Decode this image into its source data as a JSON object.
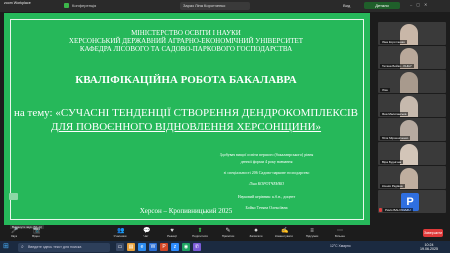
{
  "topbar": {
    "brand": "zoom Workplace",
    "conference": "Конференція",
    "speaker": "Зараз Ліна Коротченко",
    "view": "Вид",
    "pill": "Детали"
  },
  "slide": {
    "heading_1": "МІНІСТЕРСТВО ОСВІТИ І НАУКИ",
    "heading_2": "ХЕРСОНСЬКИЙ ДЕРЖАВНИЙ АГРАРНО-ЕКОНОМІЧНИЙ УНІВЕРСИТЕТ",
    "heading_3": "КАФЕДРА ЛІСОВОГО ТА САДОВО-ПАРКОВОГО ГОСПОДАРСТВА",
    "title": "КВАЛІФІКАЦІЙНА РОБОТА БАКАЛАВРА",
    "topic_line1": "на тему: «СУЧАСНІ ТЕНДЕНЦІЇ СТВОРЕННЯ ДЕНДРОКОМПЛЕКСІВ",
    "topic_line2": "ДЛЯ ПОВОЄННОГО ВІДНОВЛЕННЯ ХЕРСОНЩИНИ»",
    "info_1": "Здобувач вищої освіти першого (бакалаврського) рівня",
    "info_2": "денної форми 4 року навчання",
    "info_3": "зі спеціальності 206 Садово-паркове господарство",
    "info_4": "Ліна КОРОТЧЕНКО",
    "info_5": "Науковий керівник: к.б.н., доцент",
    "info_6": "Бойко Тетяна Олексіївна",
    "city_year": "Херсон – Кропивницький 2025"
  },
  "participants": [
    {
      "name": "Ліна Коротченко",
      "color": "#c9b7a8"
    },
    {
      "name": "Тетяна Бойко - KHGY",
      "color": "#b9a89a"
    },
    {
      "name": "Ліза",
      "color": "#a89a8d"
    },
    {
      "name": "Яна Малиганська",
      "color": "#c6b9ad"
    },
    {
      "name": "Юля Мірошніченко",
      "color": "#b7aaa0"
    },
    {
      "name": "Віра Буднічна",
      "color": "#d3c5b8"
    },
    {
      "name": "Ксенія Рядівна",
      "color": "#bfae9f"
    },
    {
      "name": "Pavlo BAH KDAZU",
      "color": "#2f6fe0",
      "initial": "P"
    }
  ],
  "toolbar": {
    "items": [
      {
        "icon": "🎤",
        "label": "Звук"
      },
      {
        "icon": "📷",
        "label": "Відео"
      },
      {
        "icon": "👥",
        "label": "Учасники"
      },
      {
        "icon": "💬",
        "label": "Чат"
      },
      {
        "icon": "♥",
        "label": "Реакції"
      },
      {
        "icon": "⬆",
        "label": "Поділитися"
      },
      {
        "icon": "✎",
        "label": "Примітки"
      },
      {
        "icon": "⏺",
        "label": "Записати"
      },
      {
        "icon": "✍",
        "label": "Коментувати"
      },
      {
        "icon": "≡",
        "label": "Підсумки"
      },
      {
        "icon": "⋯",
        "label": "Більше"
      }
    ],
    "end_button": "Завершити",
    "tooltip": "Вимкнути звук (Alt+A)"
  },
  "taskbar": {
    "search_placeholder": "Введите здесь текст для поиска",
    "weather": "12°C Хмарно",
    "time": "10:24",
    "date": "19.06.2025"
  }
}
